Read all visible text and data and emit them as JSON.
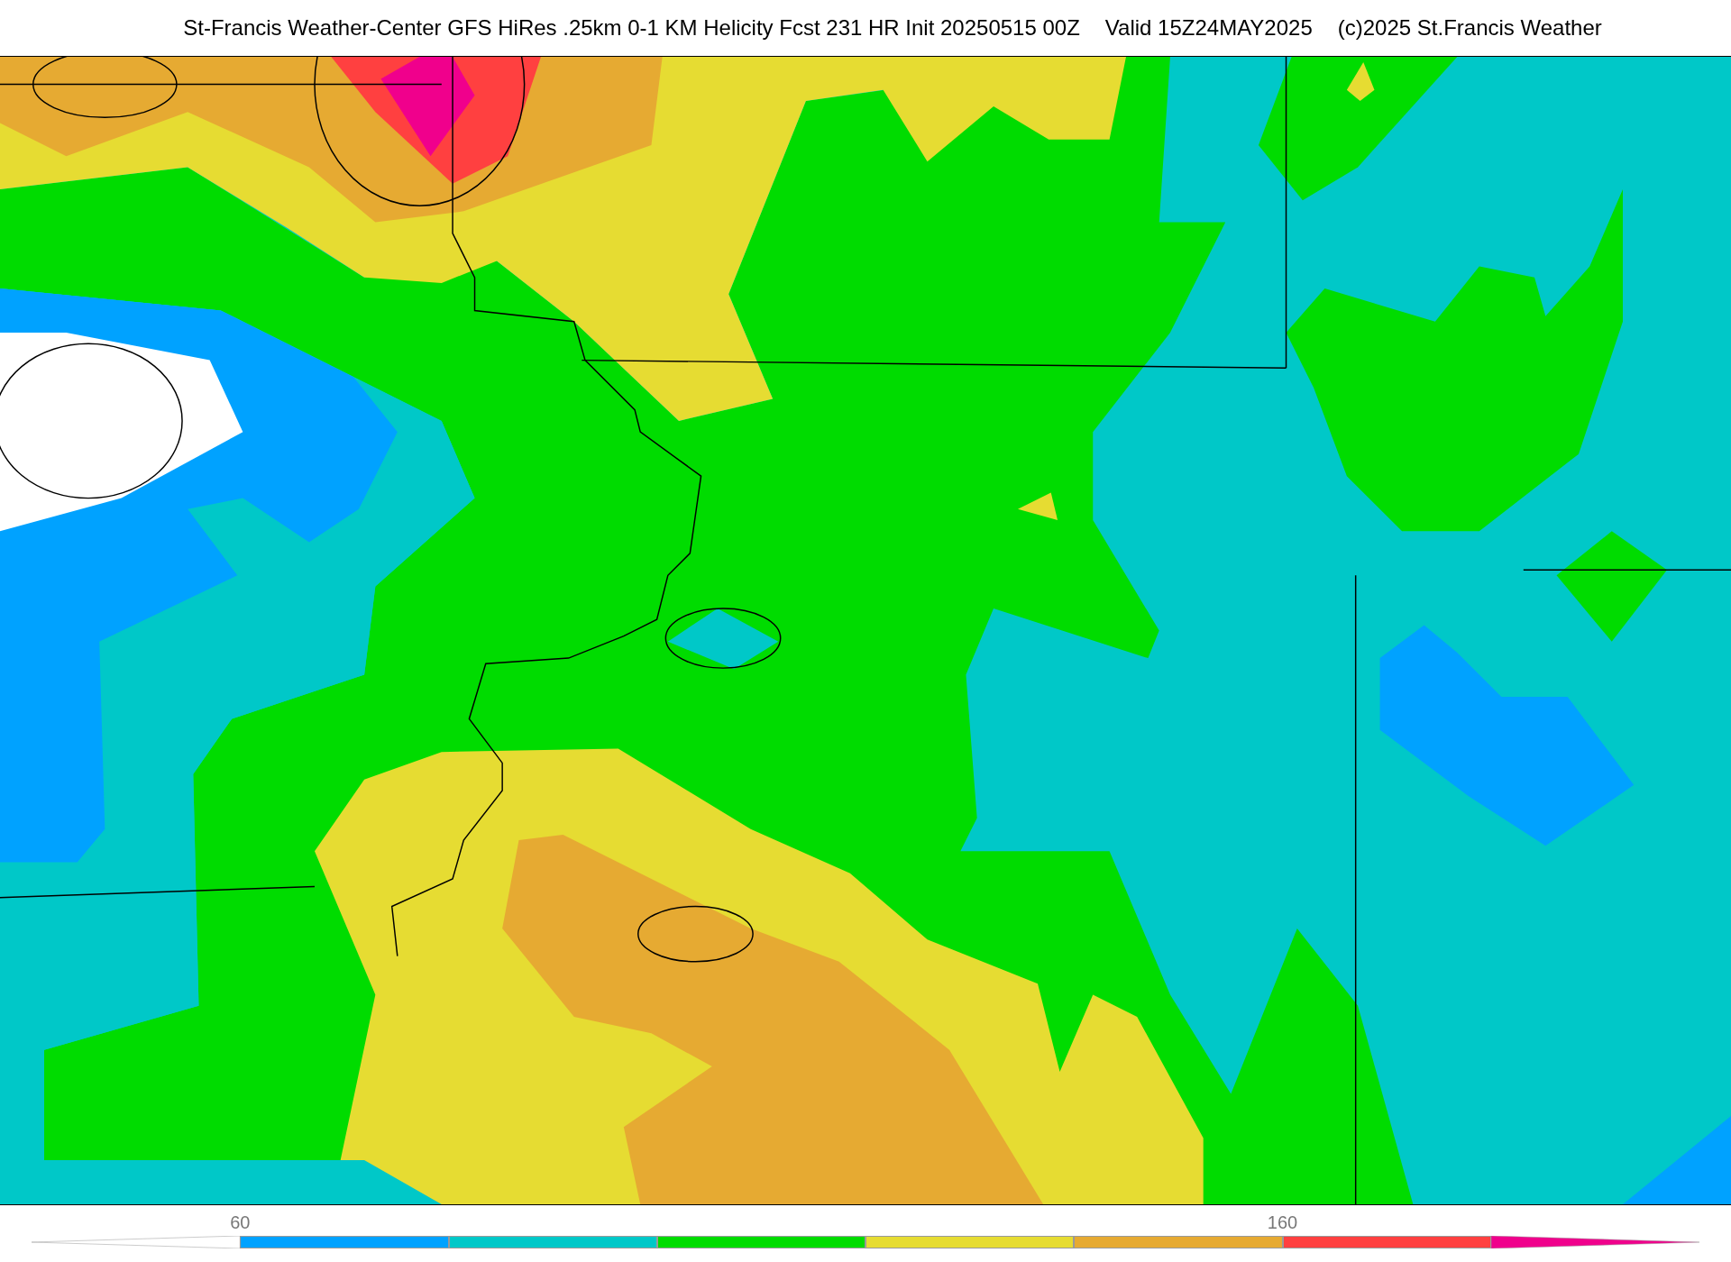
{
  "title": {
    "parts": [
      "St-Francis Weather-Center GFS HiRes .25km 0-1 KM Helicity Fcst 231 HR Init 20250515 00Z",
      "Valid 15Z24MAY2025",
      "(c)2025 St.Francis Weather"
    ]
  },
  "colorbar": {
    "segments": [
      {
        "kind": "start-arrow",
        "color": "#ffffff"
      },
      {
        "kind": "band",
        "color": "#00a2ff",
        "tick_label": "60"
      },
      {
        "kind": "band",
        "color": "#00c8c8"
      },
      {
        "kind": "band",
        "color": "#00dc00"
      },
      {
        "kind": "band",
        "color": "#e6dc32"
      },
      {
        "kind": "band",
        "color": "#e6aa32"
      },
      {
        "kind": "band",
        "color": "#ff4040",
        "tick_label": "160"
      },
      {
        "kind": "end-arrow",
        "color": "#f0008c"
      }
    ]
  }
}
